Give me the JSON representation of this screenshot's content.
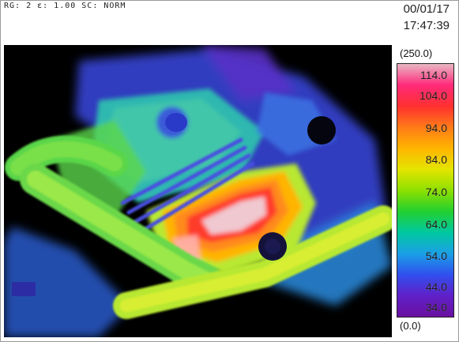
{
  "header": {
    "params": "RG: 2  ε: 1.00  SC: NORM",
    "date": "00/01/17",
    "time": "17:47:39"
  },
  "scale": {
    "range_max": "(250.0)",
    "range_min": "(0.0)",
    "ticks": [
      "114.0",
      "104.0",
      "94.0",
      "84.0",
      "74.0",
      "64.0",
      "54.0",
      "44.0",
      "34.0"
    ],
    "gradient_colors": [
      "#e8b8c4",
      "#ff2a7a",
      "#ff3030",
      "#ff7a18",
      "#ffb400",
      "#e4e400",
      "#8ee000",
      "#22d030",
      "#00c8a0",
      "#1aa0e6",
      "#3050ee",
      "#6020c8",
      "#6a10a0"
    ]
  },
  "thermal_view": {
    "palette": {
      "background": "#000000",
      "cold_blue": "#3a48e0",
      "teal": "#2fb8b0",
      "green": "#5ad64a",
      "lime": "#b8e830",
      "yellow": "#f0e020",
      "orange": "#ff8a1a",
      "red": "#ff3a2a",
      "hot": "#f0c8d0"
    }
  }
}
